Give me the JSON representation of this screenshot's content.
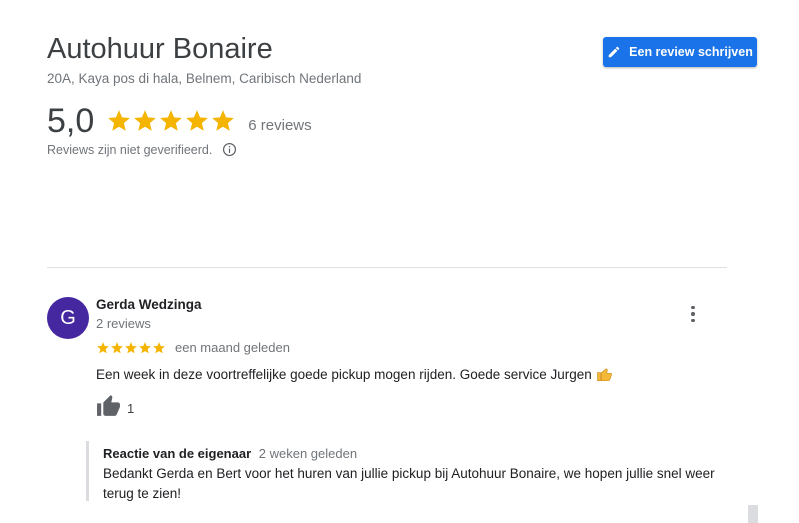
{
  "business": {
    "name": "Autohuur Bonaire",
    "address": "20A, Kaya pos di hala, Belnem, Caribisch Nederland"
  },
  "actions": {
    "write_review_label": "Een review schrijven"
  },
  "summary": {
    "rating": "5,0",
    "stars": 5,
    "review_count_label": "6 reviews",
    "not_verified_text": "Reviews zijn niet geverifieerd."
  },
  "review": {
    "avatar_initial": "G",
    "author": "Gerda Wedzinga",
    "author_reviews": "2 reviews",
    "stars": 5,
    "time": "een maand geleden",
    "text": "Een week in deze voortreffelijke goede pickup mogen rijden. Goede service Jurgen",
    "likes": "1",
    "owner_response": {
      "title": "Reactie van de eigenaar",
      "time": "2 weken geleden",
      "text": "Bedankt Gerda en Bert voor het huren van jullie pickup bij Autohuur Bonaire, we hopen jullie snel weer terug te zien!"
    }
  },
  "colors": {
    "accent": "#1a73e8",
    "star": "#f4b400",
    "avatar": "#4527a0"
  },
  "icons": [
    "pencil-icon",
    "star-icon",
    "info-icon",
    "more-vert-icon",
    "thumbs-up-icon",
    "thumbs-up-emoji"
  ]
}
